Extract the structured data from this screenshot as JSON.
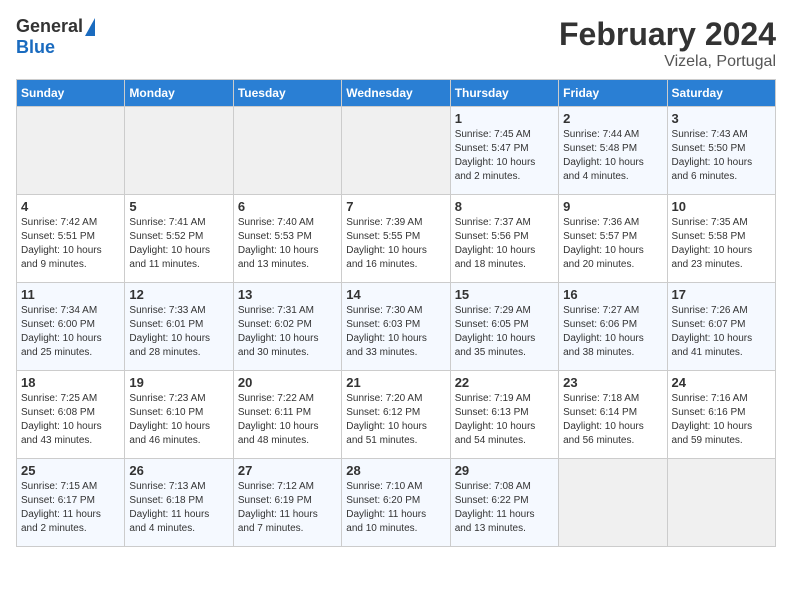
{
  "header": {
    "logo_general": "General",
    "logo_blue": "Blue",
    "title": "February 2024",
    "subtitle": "Vizela, Portugal"
  },
  "columns": [
    "Sunday",
    "Monday",
    "Tuesday",
    "Wednesday",
    "Thursday",
    "Friday",
    "Saturday"
  ],
  "weeks": [
    {
      "days": [
        {
          "num": "",
          "info": "",
          "empty": true
        },
        {
          "num": "",
          "info": "",
          "empty": true
        },
        {
          "num": "",
          "info": "",
          "empty": true
        },
        {
          "num": "",
          "info": "",
          "empty": true
        },
        {
          "num": "1",
          "info": "Sunrise: 7:45 AM\nSunset: 5:47 PM\nDaylight: 10 hours\nand 2 minutes.",
          "empty": false
        },
        {
          "num": "2",
          "info": "Sunrise: 7:44 AM\nSunset: 5:48 PM\nDaylight: 10 hours\nand 4 minutes.",
          "empty": false
        },
        {
          "num": "3",
          "info": "Sunrise: 7:43 AM\nSunset: 5:50 PM\nDaylight: 10 hours\nand 6 minutes.",
          "empty": false
        }
      ]
    },
    {
      "days": [
        {
          "num": "4",
          "info": "Sunrise: 7:42 AM\nSunset: 5:51 PM\nDaylight: 10 hours\nand 9 minutes.",
          "empty": false
        },
        {
          "num": "5",
          "info": "Sunrise: 7:41 AM\nSunset: 5:52 PM\nDaylight: 10 hours\nand 11 minutes.",
          "empty": false
        },
        {
          "num": "6",
          "info": "Sunrise: 7:40 AM\nSunset: 5:53 PM\nDaylight: 10 hours\nand 13 minutes.",
          "empty": false
        },
        {
          "num": "7",
          "info": "Sunrise: 7:39 AM\nSunset: 5:55 PM\nDaylight: 10 hours\nand 16 minutes.",
          "empty": false
        },
        {
          "num": "8",
          "info": "Sunrise: 7:37 AM\nSunset: 5:56 PM\nDaylight: 10 hours\nand 18 minutes.",
          "empty": false
        },
        {
          "num": "9",
          "info": "Sunrise: 7:36 AM\nSunset: 5:57 PM\nDaylight: 10 hours\nand 20 minutes.",
          "empty": false
        },
        {
          "num": "10",
          "info": "Sunrise: 7:35 AM\nSunset: 5:58 PM\nDaylight: 10 hours\nand 23 minutes.",
          "empty": false
        }
      ]
    },
    {
      "days": [
        {
          "num": "11",
          "info": "Sunrise: 7:34 AM\nSunset: 6:00 PM\nDaylight: 10 hours\nand 25 minutes.",
          "empty": false
        },
        {
          "num": "12",
          "info": "Sunrise: 7:33 AM\nSunset: 6:01 PM\nDaylight: 10 hours\nand 28 minutes.",
          "empty": false
        },
        {
          "num": "13",
          "info": "Sunrise: 7:31 AM\nSunset: 6:02 PM\nDaylight: 10 hours\nand 30 minutes.",
          "empty": false
        },
        {
          "num": "14",
          "info": "Sunrise: 7:30 AM\nSunset: 6:03 PM\nDaylight: 10 hours\nand 33 minutes.",
          "empty": false
        },
        {
          "num": "15",
          "info": "Sunrise: 7:29 AM\nSunset: 6:05 PM\nDaylight: 10 hours\nand 35 minutes.",
          "empty": false
        },
        {
          "num": "16",
          "info": "Sunrise: 7:27 AM\nSunset: 6:06 PM\nDaylight: 10 hours\nand 38 minutes.",
          "empty": false
        },
        {
          "num": "17",
          "info": "Sunrise: 7:26 AM\nSunset: 6:07 PM\nDaylight: 10 hours\nand 41 minutes.",
          "empty": false
        }
      ]
    },
    {
      "days": [
        {
          "num": "18",
          "info": "Sunrise: 7:25 AM\nSunset: 6:08 PM\nDaylight: 10 hours\nand 43 minutes.",
          "empty": false
        },
        {
          "num": "19",
          "info": "Sunrise: 7:23 AM\nSunset: 6:10 PM\nDaylight: 10 hours\nand 46 minutes.",
          "empty": false
        },
        {
          "num": "20",
          "info": "Sunrise: 7:22 AM\nSunset: 6:11 PM\nDaylight: 10 hours\nand 48 minutes.",
          "empty": false
        },
        {
          "num": "21",
          "info": "Sunrise: 7:20 AM\nSunset: 6:12 PM\nDaylight: 10 hours\nand 51 minutes.",
          "empty": false
        },
        {
          "num": "22",
          "info": "Sunrise: 7:19 AM\nSunset: 6:13 PM\nDaylight: 10 hours\nand 54 minutes.",
          "empty": false
        },
        {
          "num": "23",
          "info": "Sunrise: 7:18 AM\nSunset: 6:14 PM\nDaylight: 10 hours\nand 56 minutes.",
          "empty": false
        },
        {
          "num": "24",
          "info": "Sunrise: 7:16 AM\nSunset: 6:16 PM\nDaylight: 10 hours\nand 59 minutes.",
          "empty": false
        }
      ]
    },
    {
      "days": [
        {
          "num": "25",
          "info": "Sunrise: 7:15 AM\nSunset: 6:17 PM\nDaylight: 11 hours\nand 2 minutes.",
          "empty": false
        },
        {
          "num": "26",
          "info": "Sunrise: 7:13 AM\nSunset: 6:18 PM\nDaylight: 11 hours\nand 4 minutes.",
          "empty": false
        },
        {
          "num": "27",
          "info": "Sunrise: 7:12 AM\nSunset: 6:19 PM\nDaylight: 11 hours\nand 7 minutes.",
          "empty": false
        },
        {
          "num": "28",
          "info": "Sunrise: 7:10 AM\nSunset: 6:20 PM\nDaylight: 11 hours\nand 10 minutes.",
          "empty": false
        },
        {
          "num": "29",
          "info": "Sunrise: 7:08 AM\nSunset: 6:22 PM\nDaylight: 11 hours\nand 13 minutes.",
          "empty": false
        },
        {
          "num": "",
          "info": "",
          "empty": true
        },
        {
          "num": "",
          "info": "",
          "empty": true
        }
      ]
    }
  ]
}
